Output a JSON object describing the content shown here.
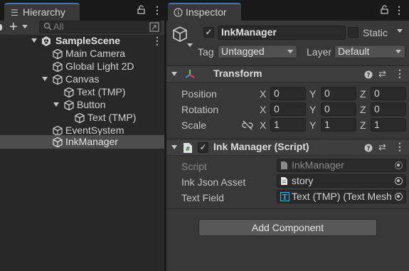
{
  "hierarchy": {
    "tab_label": "Hierarchy",
    "search_placeholder": "All",
    "add_button": "+",
    "scene_name": "SampleScene",
    "items": [
      {
        "label": "Main Camera"
      },
      {
        "label": "Global Light 2D"
      },
      {
        "label": "Canvas"
      },
      {
        "label": "Text (TMP)"
      },
      {
        "label": "Button"
      },
      {
        "label": "Text (TMP)"
      },
      {
        "label": "EventSystem"
      },
      {
        "label": "InkManager"
      }
    ]
  },
  "inspector": {
    "tab_label": "Inspector",
    "object_name": "InkManager",
    "static_label": "Static",
    "tag_label": "Tag",
    "tag_value": "Untagged",
    "layer_label": "Layer",
    "layer_value": "Default",
    "transform": {
      "title": "Transform",
      "position_label": "Position",
      "rotation_label": "Rotation",
      "scale_label": "Scale",
      "x_label": "X",
      "y_label": "Y",
      "z_label": "Z",
      "position": {
        "x": "0",
        "y": "0",
        "z": "0"
      },
      "rotation": {
        "x": "0",
        "y": "0",
        "z": "0"
      },
      "scale": {
        "x": "1",
        "y": "1",
        "z": "1"
      }
    },
    "script_component": {
      "title": "Ink Manager (Script)",
      "script_label": "Script",
      "script_value": "InkManager",
      "json_label": "Ink Json Asset",
      "json_value": "story",
      "text_field_label": "Text Field",
      "text_field_value": "Text (TMP) (Text Mesh"
    },
    "add_component_label": "Add Component"
  },
  "colors": {
    "selection": "#4d4d4d",
    "tab_accent": "#3a79bb"
  }
}
